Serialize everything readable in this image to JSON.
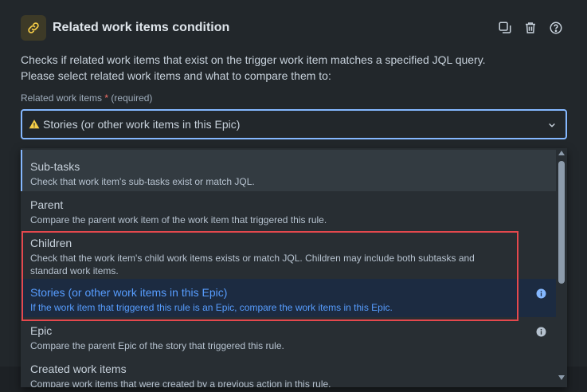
{
  "header": {
    "title": "Related work items condition",
    "icon": "link-icon",
    "actions": [
      "duplicate-icon",
      "trash-icon",
      "help-icon"
    ]
  },
  "description": {
    "line1": "Checks if related work items that exist on the trigger work item matches a specified JQL query.",
    "line2": "Please select related work items and what to compare them to:"
  },
  "field": {
    "label": "Related work items",
    "required_mark": "*",
    "required_text": "(required)",
    "selected_value": "Stories (or other work items in this Epic)"
  },
  "options": [
    {
      "title": "Sub-tasks",
      "subtitle": "Check that work item's sub-tasks exist or match JQL."
    },
    {
      "title": "Parent",
      "subtitle": "Compare the parent work item of the work item that triggered this rule."
    },
    {
      "title": "Children",
      "subtitle_line1": "Check that the work item's child work items exists or match JQL. Children may include both subtasks and",
      "subtitle_line2": "standard work items."
    },
    {
      "title": "Stories (or other work items in this Epic)",
      "subtitle": "If the work item that triggered this rule is an Epic, compare the work items in this Epic."
    },
    {
      "title": "Epic",
      "subtitle": "Compare the parent Epic of the story that triggered this rule."
    },
    {
      "title": "Created work items",
      "subtitle": "Compare work items that were created by a previous action in this rule."
    }
  ],
  "colors": {
    "accent": "#579dff",
    "focus_border": "#85b8ff",
    "highlight_box": "#e5484d",
    "required": "#f87168",
    "warning": "#f5cd47"
  }
}
